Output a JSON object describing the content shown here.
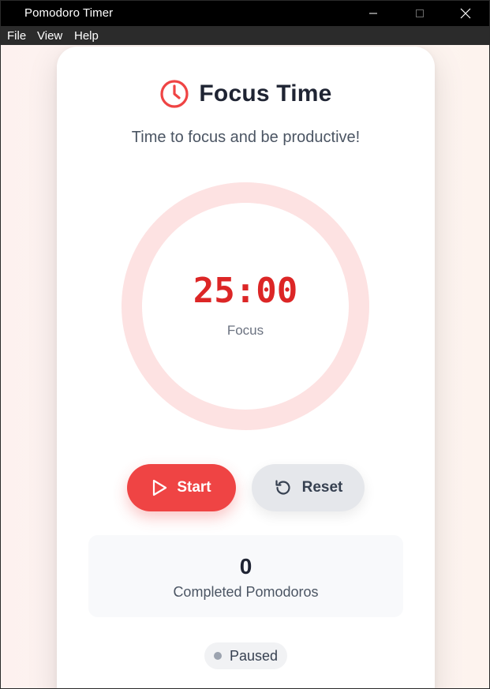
{
  "window": {
    "title": "Pomodoro Timer"
  },
  "menu": {
    "items": [
      "File",
      "View",
      "Help"
    ]
  },
  "header": {
    "icon": "clock-icon",
    "title": "Focus Time",
    "subtitle": "Time to focus and be productive!"
  },
  "timer": {
    "time": "25:00",
    "phase": "Focus",
    "progress": 0,
    "ring_color": "#fde2e2",
    "accent": "#dc2626"
  },
  "controls": {
    "start_label": "Start",
    "start_icon": "play-icon",
    "reset_label": "Reset",
    "reset_icon": "reset-icon"
  },
  "stats": {
    "count": "0",
    "label": "Completed Pomodoros"
  },
  "status": {
    "label": "Paused",
    "dot_color": "#9ca3af"
  }
}
